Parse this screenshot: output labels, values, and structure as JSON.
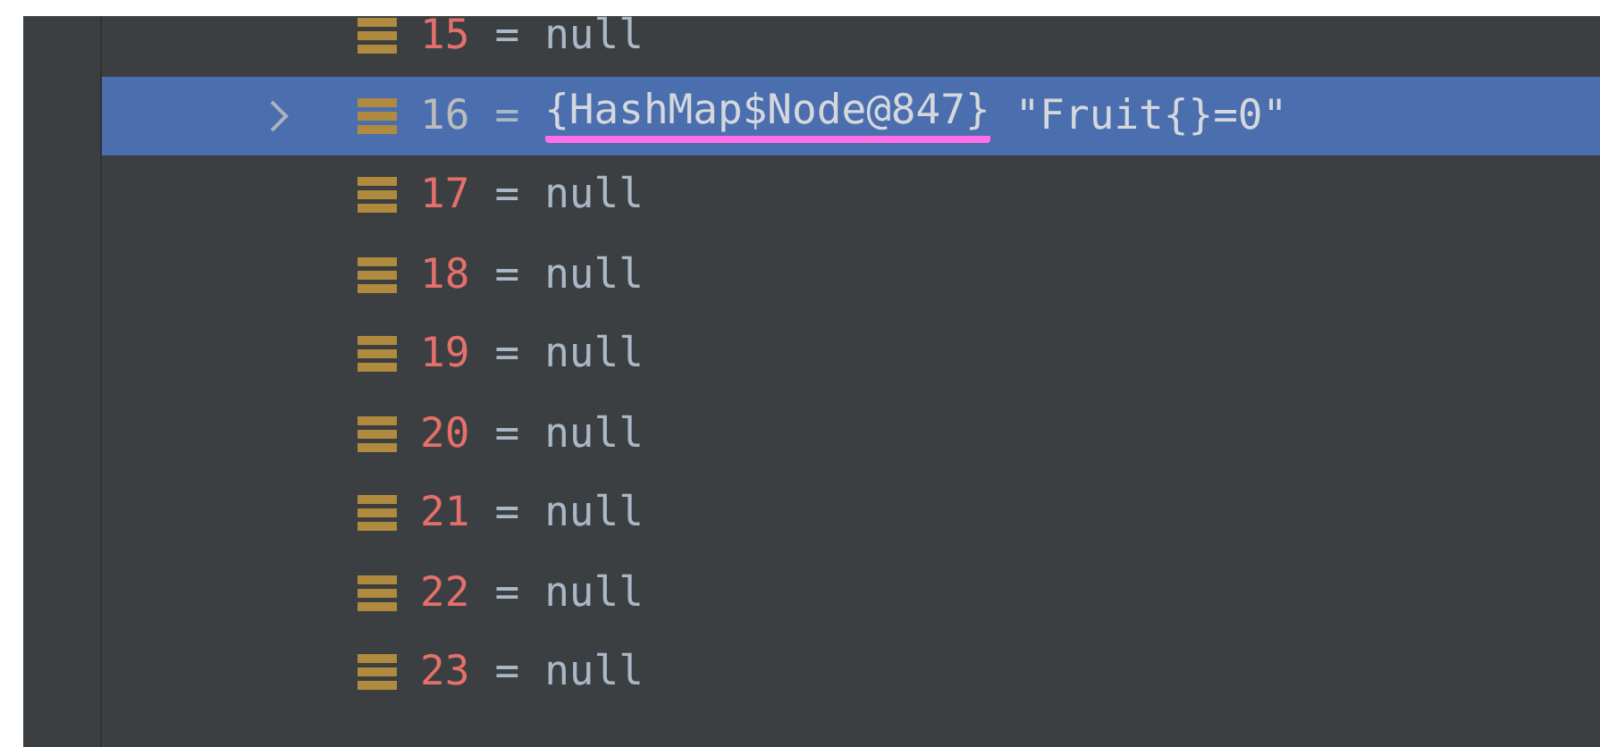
{
  "rows": [
    {
      "index": "15",
      "sign": "=",
      "value": "null",
      "selected": false,
      "expandable": false
    },
    {
      "index": "16",
      "sign": "=",
      "ref": "{HashMap$Node@847}",
      "value": "\"Fruit{}=0\"",
      "selected": true,
      "expandable": true,
      "underlined": true
    },
    {
      "index": "17",
      "sign": "=",
      "value": "null",
      "selected": false,
      "expandable": false
    },
    {
      "index": "18",
      "sign": "=",
      "value": "null",
      "selected": false,
      "expandable": false
    },
    {
      "index": "19",
      "sign": "=",
      "value": "null",
      "selected": false,
      "expandable": false
    },
    {
      "index": "20",
      "sign": "=",
      "value": "null",
      "selected": false,
      "expandable": false
    },
    {
      "index": "21",
      "sign": "=",
      "value": "null",
      "selected": false,
      "expandable": false
    },
    {
      "index": "22",
      "sign": "=",
      "value": "null",
      "selected": false,
      "expandable": false
    },
    {
      "index": "23",
      "sign": "=",
      "value": "null",
      "selected": false,
      "expandable": false
    }
  ]
}
